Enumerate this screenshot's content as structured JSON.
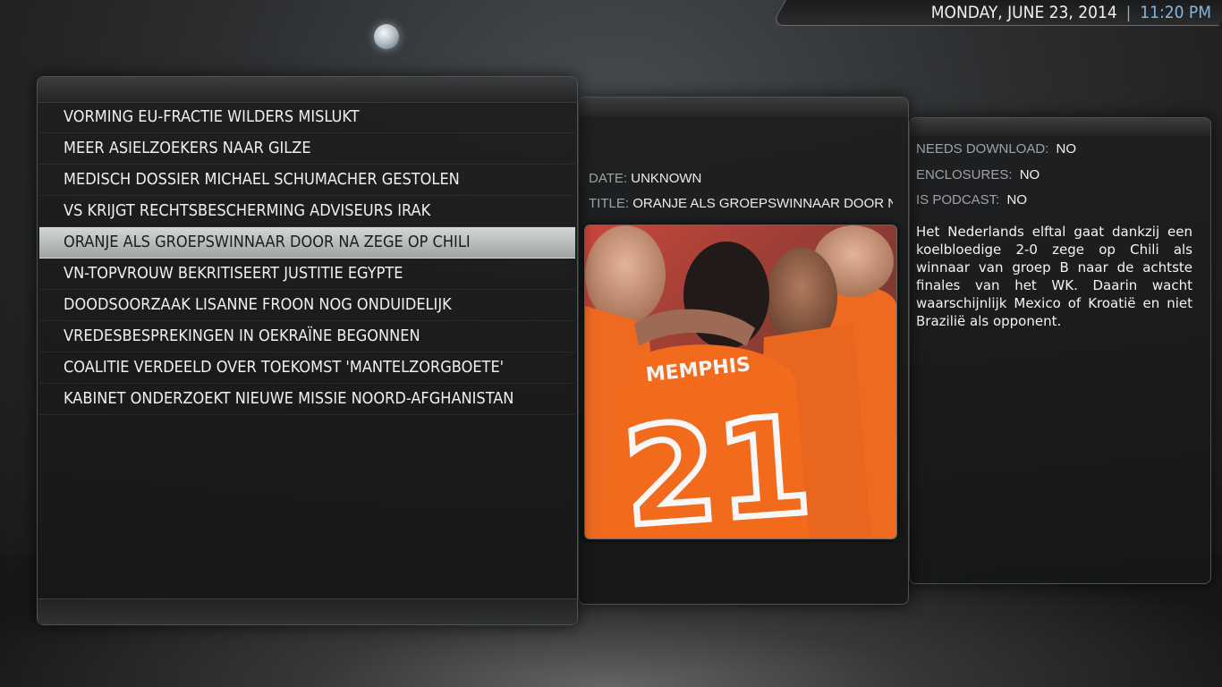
{
  "header": {
    "date": "MONDAY, JUNE 23, 2014",
    "separator": "|",
    "time": "11:20 PM"
  },
  "feed_list": {
    "items": [
      "VORMING EU-FRACTIE WILDERS MISLUKT",
      "MEER ASIELZOEKERS NAAR GILZE",
      "MEDISCH DOSSIER MICHAEL SCHUMACHER GESTOLEN",
      "VS KRIJGT RECHTSBESCHERMING ADVISEURS IRAK",
      "ORANJE ALS GROEPSWINNAAR DOOR NA ZEGE OP CHILI",
      "VN-TOPVROUW BEKRITISEERT JUSTITIE EGYPTE",
      "DOODSOORZAAK LISANNE FROON NOG ONDUIDELIJK",
      "VREDESBESPREKINGEN IN OEKRAÏNE BEGONNEN",
      "COALITIE VERDEELD OVER TOEKOMST 'MANTELZORGBOETE'",
      "KABINET ONDERZOEKT NIEUWE MISSIE NOORD-AFGHANISTAN"
    ],
    "selected_index": 4
  },
  "details": {
    "date_label": "DATE:",
    "date_value": "UNKNOWN",
    "title_label": "TITLE:",
    "title_value": "ORANJE ALS GROEPSWINNAAR DOOR NA ZEGE OP CHILI",
    "thumbnail": {
      "jersey_name": "MEMPHIS",
      "jersey_number": "21"
    }
  },
  "info": {
    "needs_download_label": "NEEDS DOWNLOAD:",
    "needs_download_value": "NO",
    "enclosures_label": "ENCLOSURES:",
    "enclosures_value": "NO",
    "is_podcast_label": "IS PODCAST:",
    "is_podcast_value": "NO",
    "description": "Het Nederlands elftal gaat dankzij een koelbloedige 2-0 zege op Chili als winnaar van groep B naar de achtste finales van het WK. Daarin wacht waarschijnlijk Mexico of Kroatië en niet Brazilië als opponent."
  },
  "colors": {
    "accent_time": "#7fb8e6",
    "selection": "#c4c6c7",
    "jersey_orange": "#f26a1b"
  }
}
